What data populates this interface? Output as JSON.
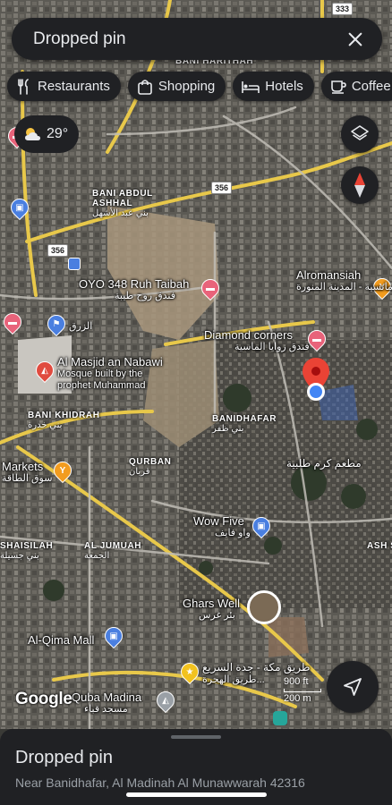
{
  "search": {
    "title": "Dropped pin"
  },
  "chips": [
    {
      "label": "Restaurants",
      "icon": "fork-knife-icon"
    },
    {
      "label": "Shopping",
      "icon": "shopping-bag-icon"
    },
    {
      "label": "Hotels",
      "icon": "bed-icon"
    },
    {
      "label": "Coffee",
      "icon": "coffee-cup-icon"
    }
  ],
  "weather": {
    "temp": "29°",
    "icon": "partly-cloudy-icon"
  },
  "map": {
    "areas": [
      {
        "en": "BANI HARITHAH",
        "ar": ""
      },
      {
        "en": "BANI ABDUL ASHHAL",
        "ar": "بني عبد الأشهل"
      },
      {
        "en": "BANI KHIDRAH",
        "ar": "بني خدرة"
      },
      {
        "en": "BANIDHAFAR",
        "ar": "بني ظفر"
      },
      {
        "en": "QURBAN",
        "ar": "قربان"
      },
      {
        "en": "AL JUMUAH",
        "ar": "الجمعة"
      },
      {
        "en": "SHAISILAH",
        "ar": "بني جسيلة"
      },
      {
        "en": "ASH S",
        "ar": ""
      }
    ],
    "pois": [
      {
        "name": "OYO 348 Ruh Taibah",
        "sub": "فندق روح طيبة",
        "color": "#e8637a"
      },
      {
        "name": "Alromansiah",
        "sub": "الرومانسية - المدينة المنورة",
        "color": "#f29c1f"
      },
      {
        "name": "Diamond corners",
        "sub": "فندق زوايا الماسية",
        "color": "#e8637a"
      },
      {
        "name": "Al Masjid an Nabawi",
        "sub": "Mosque built by the prophet Muhammad",
        "color": "#e04b3f"
      },
      {
        "name": "Markets",
        "sub": "سوق الطاقة",
        "color": "#f29c1f"
      },
      {
        "name": "Wow Five",
        "sub": "واو فايف",
        "color": "#4a7fe0"
      },
      {
        "name": "Ghars Well",
        "sub": "بئر غرس",
        "color": "#ffffff"
      },
      {
        "name": "Al-Qima Mall",
        "sub": "",
        "color": "#4a7fe0"
      },
      {
        "name": "Quba Madina",
        "sub": "مسجد قباء",
        "color": "#9aa0a6"
      },
      {
        "name": "طريق مكة - جدة السريع",
        "sub": "طريق الهجرة...",
        "color": "#f2c21f"
      },
      {
        "name": "مطعم كرم طلبية",
        "sub": "",
        "color": "#e8637a"
      },
      {
        "name": "الزرق",
        "sub": "",
        "color": "#4a7fe0"
      }
    ],
    "road_shields": [
      "333",
      "356",
      "356"
    ]
  },
  "scale": {
    "line1": "900 ft",
    "line2": "200 m"
  },
  "logo": "Google",
  "sheet": {
    "title": "Dropped pin",
    "address": "Near Banidhafar, Al Madinah Al Munawwarah 42316"
  },
  "colors": {
    "surface": "#202124",
    "pin": "#ea4335",
    "location_dot": "#4285f4"
  }
}
